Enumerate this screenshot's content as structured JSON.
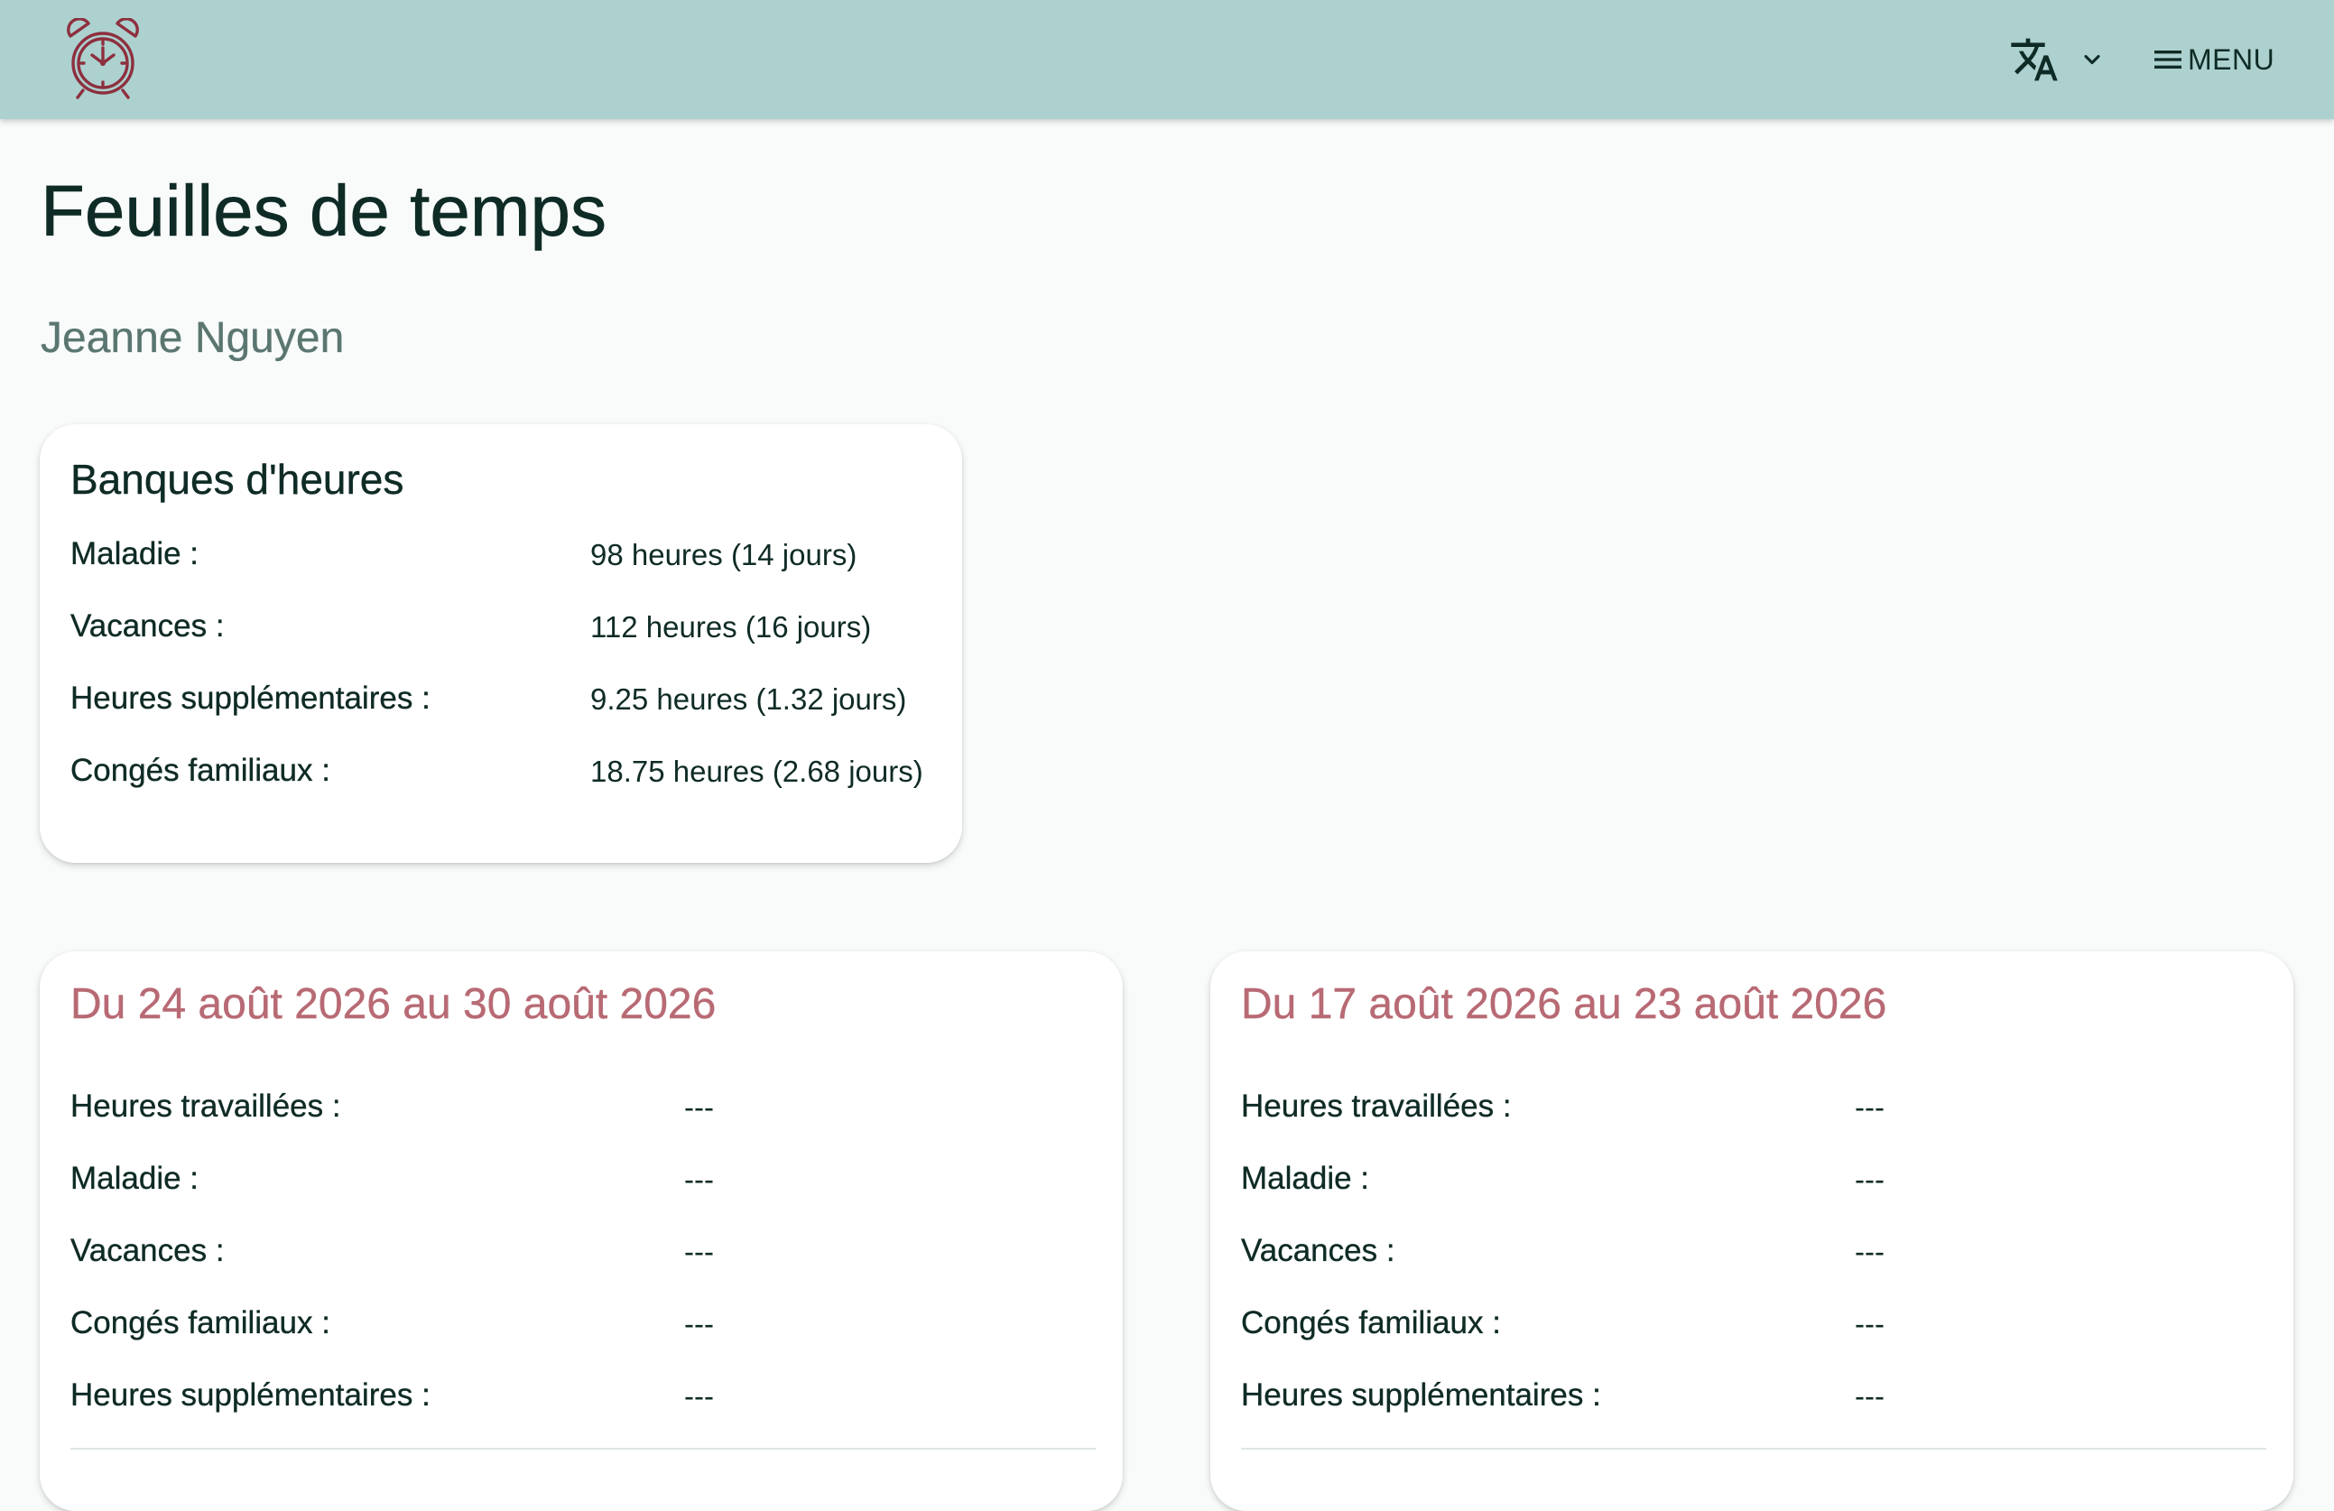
{
  "header": {
    "logo_icon": "alarm-clock-icon",
    "language_icon": "translate-icon",
    "language_dropdown_icon": "chevron-down-icon",
    "menu_icon": "hamburger-menu-icon",
    "menu_label": "MENU",
    "background_color": "#acd1cf"
  },
  "page": {
    "title": "Feuilles de temps",
    "employee_name": "Jeanne Nguyen"
  },
  "bank": {
    "title": "Banques d'heures",
    "rows": [
      {
        "label": "Maladie :",
        "value": "98 heures (14 jours)"
      },
      {
        "label": "Vacances :",
        "value": "112 heures (16 jours)"
      },
      {
        "label": "Heures supplémentaires :",
        "value": "9.25 heures (1.32 jours)"
      },
      {
        "label": "Congés familiaux :",
        "value": "18.75 heures (2.68 jours)"
      }
    ]
  },
  "weeks": [
    {
      "title": "Du 24 août 2026 au 30 août 2026",
      "rows": [
        {
          "label": "Heures travaillées :",
          "value": "---"
        },
        {
          "label": "Maladie :",
          "value": "---"
        },
        {
          "label": "Vacances :",
          "value": "---"
        },
        {
          "label": "Congés familiaux :",
          "value": "---"
        },
        {
          "label": "Heures supplémentaires :",
          "value": "---"
        }
      ]
    },
    {
      "title": "Du 17 août 2026 au 23 août 2026",
      "rows": [
        {
          "label": "Heures travaillées :",
          "value": "---"
        },
        {
          "label": "Maladie :",
          "value": "---"
        },
        {
          "label": "Vacances :",
          "value": "---"
        },
        {
          "label": "Congés familiaux :",
          "value": "---"
        },
        {
          "label": "Heures supplémentaires :",
          "value": "---"
        }
      ]
    }
  ],
  "colors": {
    "accent": "#b86a74",
    "text": "#0f2b26",
    "muted": "#5b7671",
    "page_background": "#f8fbfa"
  }
}
